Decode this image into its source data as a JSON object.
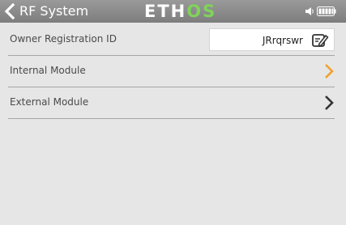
{
  "header": {
    "title": "RF System",
    "logo_main": "ETH",
    "logo_accent": "OS"
  },
  "rows": [
    {
      "label": "Owner Registration ID",
      "value": "JRrqrswr"
    },
    {
      "label": "Internal Module"
    },
    {
      "label": "External Module"
    }
  ],
  "colors": {
    "header_bg": "#8c8c8c",
    "content_bg": "#e6e6e6",
    "accent_orange": "#f0a030",
    "logo_green": "#7fd35a"
  },
  "icons": {
    "back": "back-chevron-icon",
    "speaker": "speaker-icon",
    "battery": "battery-icon",
    "edit": "edit-icon",
    "chevron": "chevron-right-icon"
  }
}
